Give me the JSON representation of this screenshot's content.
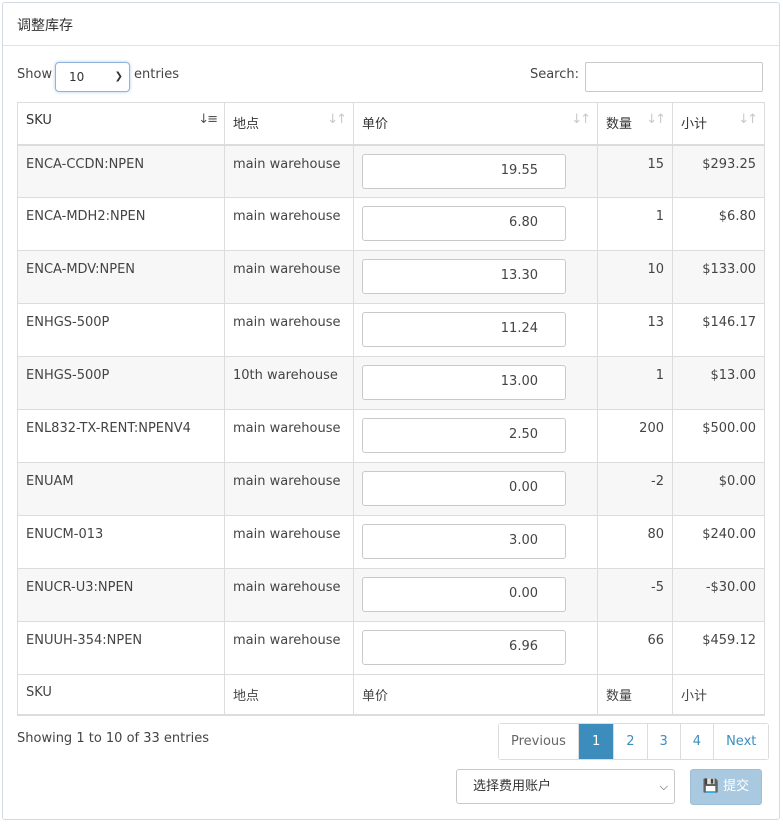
{
  "panel": {
    "title": "调整库存"
  },
  "length": {
    "show_label": "Show",
    "value": "10",
    "entries_label": "entries"
  },
  "search": {
    "label": "Search:",
    "value": ""
  },
  "columns": [
    "SKU",
    "地点",
    "单价",
    "数量",
    "小计"
  ],
  "sort": {
    "active_icon": "sort-amount-asc-icon",
    "inactive_icon": "sort-icon"
  },
  "rows": [
    {
      "sku": "ENCA-CCDN:NPEN",
      "location": "main warehouse",
      "price": "19.55",
      "qty": "15",
      "subtotal": "$293.25"
    },
    {
      "sku": "ENCA-MDH2:NPEN",
      "location": "main warehouse",
      "price": "6.80",
      "qty": "1",
      "subtotal": "$6.80"
    },
    {
      "sku": "ENCA-MDV:NPEN",
      "location": "main warehouse",
      "price": "13.30",
      "qty": "10",
      "subtotal": "$133.00"
    },
    {
      "sku": "ENHGS-500P",
      "location": "main warehouse",
      "price": "11.24",
      "qty": "13",
      "subtotal": "$146.17"
    },
    {
      "sku": "ENHGS-500P",
      "location": "10th warehouse",
      "price": "13.00",
      "qty": "1",
      "subtotal": "$13.00"
    },
    {
      "sku": "ENL832-TX-RENT:NPENV4",
      "location": "main warehouse",
      "price": "2.50",
      "qty": "200",
      "subtotal": "$500.00"
    },
    {
      "sku": "ENUAM",
      "location": "main warehouse",
      "price": "0.00",
      "qty": "-2",
      "subtotal": "$0.00"
    },
    {
      "sku": "ENUCM-013",
      "location": "main warehouse",
      "price": "3.00",
      "qty": "80",
      "subtotal": "$240.00"
    },
    {
      "sku": "ENUCR-U3:NPEN",
      "location": "main warehouse",
      "price": "0.00",
      "qty": "-5",
      "subtotal": "-$30.00"
    },
    {
      "sku": "ENUUH-354:NPEN",
      "location": "main warehouse",
      "price": "6.96",
      "qty": "66",
      "subtotal": "$459.12"
    }
  ],
  "info": "Showing 1 to 10 of 33 entries",
  "pagination": {
    "previous": "Previous",
    "pages": [
      "1",
      "2",
      "3",
      "4"
    ],
    "current": "1",
    "next": "Next"
  },
  "account": {
    "selected": "选择费用账户"
  },
  "submit": {
    "label": "提交",
    "icon": "save-icon"
  },
  "colors": {
    "accent": "#3c8dbc",
    "submit_disabled": "#a9c9e0"
  }
}
